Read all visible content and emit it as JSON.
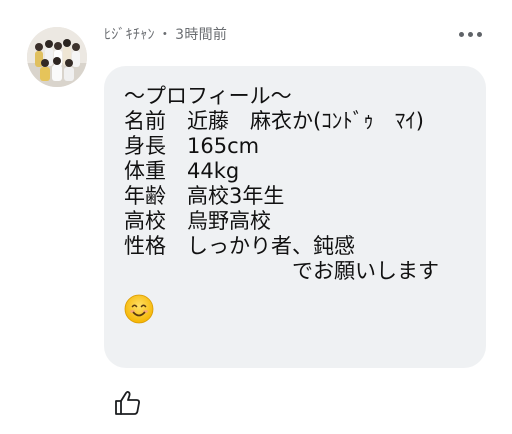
{
  "post": {
    "author": "ﾋｼﾞｷﾁｬﾝ",
    "separator": "・",
    "time": "3時間前",
    "body_text": "〜プロフィール〜\n名前　近藤　麻衣か(ｺﾝﾄﾞｩ　ﾏｲ)\n身長　165cm\n体重　44kg\n年齢　高校3年生\n高校　烏野高校\n性格　しっかり者、鈍感\n　　　　　　　　でお願いします",
    "emoji": "smiling-face-emoji"
  },
  "icons": {
    "more": "more-options-icon",
    "like": "thumbs-up-icon"
  },
  "colors": {
    "bubble": "#eff1f3",
    "meta_text": "#6b6e72",
    "body_text": "#111111"
  }
}
